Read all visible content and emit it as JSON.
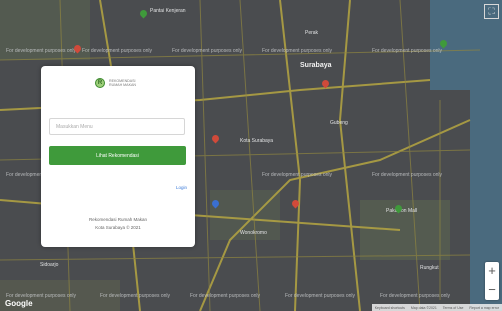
{
  "map": {
    "watermark": "For development purposes only",
    "city_label": "Surabaya",
    "places": [
      "Pantai Kenjeran",
      "Pakuwon Mall",
      "Kota Surabaya",
      "Perak",
      "Gubeng",
      "Wonokromo",
      "Rungkut",
      "Sidoarjo"
    ],
    "google_logo": "Google",
    "fullscreen_icon": "fullscreen-icon",
    "zoom_in_label": "+",
    "zoom_out_label": "−",
    "footer_items": [
      "Keyboard shortcuts",
      "Map data ©2021",
      "Terms of Use",
      "Report a map error"
    ]
  },
  "panel": {
    "logo_line1": "REKOMENDASI",
    "logo_line2": "RUMAH MAKAN",
    "search_placeholder": "Masukkan Menu",
    "primary_button": "Lihat Rekomendasi",
    "login_link": "Login",
    "footer_line1": "Rekomendasi Rumah Makan",
    "footer_line2": "Kota Surabaya © 2021"
  },
  "colors": {
    "accent_green": "#3f9a3b",
    "map_dark": "#4a4c4f",
    "road_yellow": "#b5a642",
    "water": "#4a6a7e"
  }
}
